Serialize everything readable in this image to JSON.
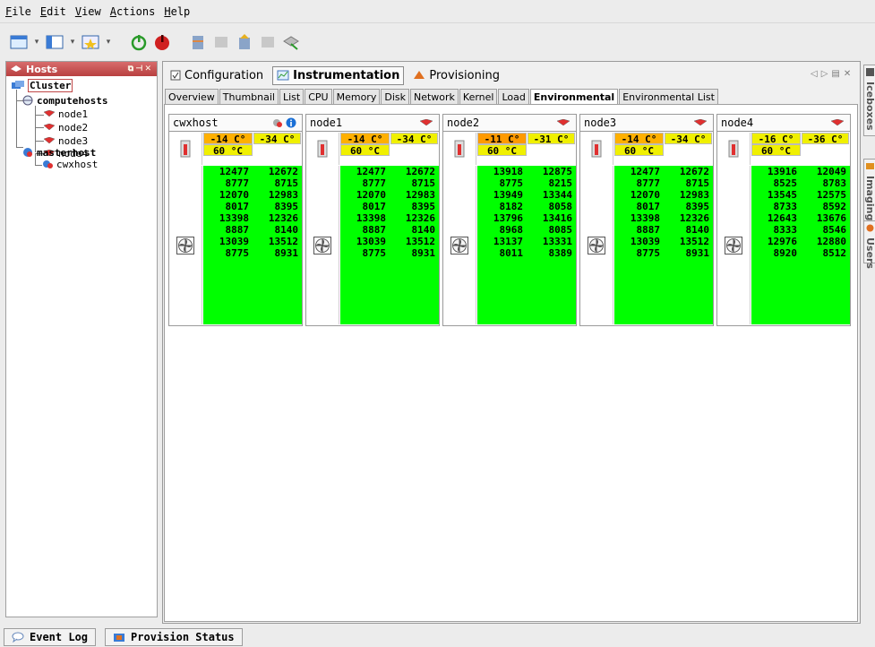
{
  "menu": [
    "File",
    "Edit",
    "View",
    "Actions",
    "Help"
  ],
  "hosts_panel": {
    "title": "Hosts",
    "tree": {
      "cluster": "Cluster",
      "computehosts": "computehosts",
      "nodes": [
        "node1",
        "node2",
        "node3",
        "node4"
      ],
      "masterhost": "masterhost",
      "master_child": "cwxhost"
    }
  },
  "top_tabs": [
    "Configuration",
    "Instrumentation",
    "Provisioning"
  ],
  "sub_tabs": [
    "Overview",
    "Thumbnail",
    "List",
    "CPU",
    "Memory",
    "Disk",
    "Network",
    "Kernel",
    "Load",
    "Environmental",
    "Environmental List"
  ],
  "hosts": [
    {
      "name": "cwxhost",
      "temps": [
        "-14 C°",
        "-34 C°",
        "60 °C"
      ],
      "temp_colors": [
        "#ffb000",
        "#f0f000",
        "#f0f000"
      ],
      "fan_col1": [
        "12477",
        "8777",
        "12070",
        "8017",
        "13398",
        "8887",
        "13039",
        "8775"
      ],
      "fan_col2": [
        "12672",
        "8715",
        "12983",
        "8395",
        "12326",
        "8140",
        "13512",
        "8931"
      ]
    },
    {
      "name": "node1",
      "temps": [
        "-14 C°",
        "-34 C°",
        "60 °C"
      ],
      "temp_colors": [
        "#ffb000",
        "#f0f000",
        "#f0f000"
      ],
      "fan_col1": [
        "12477",
        "8777",
        "12070",
        "8017",
        "13398",
        "8887",
        "13039",
        "8775"
      ],
      "fan_col2": [
        "12672",
        "8715",
        "12983",
        "8395",
        "12326",
        "8140",
        "13512",
        "8931"
      ]
    },
    {
      "name": "node2",
      "temps": [
        "-11 C°",
        "-31 C°",
        "60 °C"
      ],
      "temp_colors": [
        "#ff9a00",
        "#f0f000",
        "#f0f000"
      ],
      "fan_col1": [
        "13918",
        "8775",
        "13949",
        "8182",
        "13796",
        "8968",
        "13137",
        "8011"
      ],
      "fan_col2": [
        "12875",
        "8215",
        "13344",
        "8058",
        "13416",
        "8085",
        "13331",
        "8389"
      ]
    },
    {
      "name": "node3",
      "temps": [
        "-14 C°",
        "-34 C°",
        "60 °C"
      ],
      "temp_colors": [
        "#ffb000",
        "#f0f000",
        "#f0f000"
      ],
      "fan_col1": [
        "12477",
        "8777",
        "12070",
        "8017",
        "13398",
        "8887",
        "13039",
        "8775"
      ],
      "fan_col2": [
        "12672",
        "8715",
        "12983",
        "8395",
        "12326",
        "8140",
        "13512",
        "8931"
      ]
    },
    {
      "name": "node4",
      "temps": [
        "-16 C°",
        "-36 C°",
        "60 °C"
      ],
      "temp_colors": [
        "#f0f000",
        "#f0f000",
        "#f0f000"
      ],
      "fan_col1": [
        "13916",
        "8525",
        "13545",
        "8733",
        "12643",
        "8333",
        "12976",
        "8920"
      ],
      "fan_col2": [
        "12049",
        "8783",
        "12575",
        "8592",
        "13676",
        "8546",
        "12880",
        "8512"
      ]
    }
  ],
  "side_tabs": [
    "Iceboxes",
    "Imaging",
    "Users"
  ],
  "bottom_tabs": [
    "Event Log",
    "Provision Status"
  ],
  "colors": {
    "fan_ok": "#00ff00",
    "header_red": "#c04848"
  }
}
